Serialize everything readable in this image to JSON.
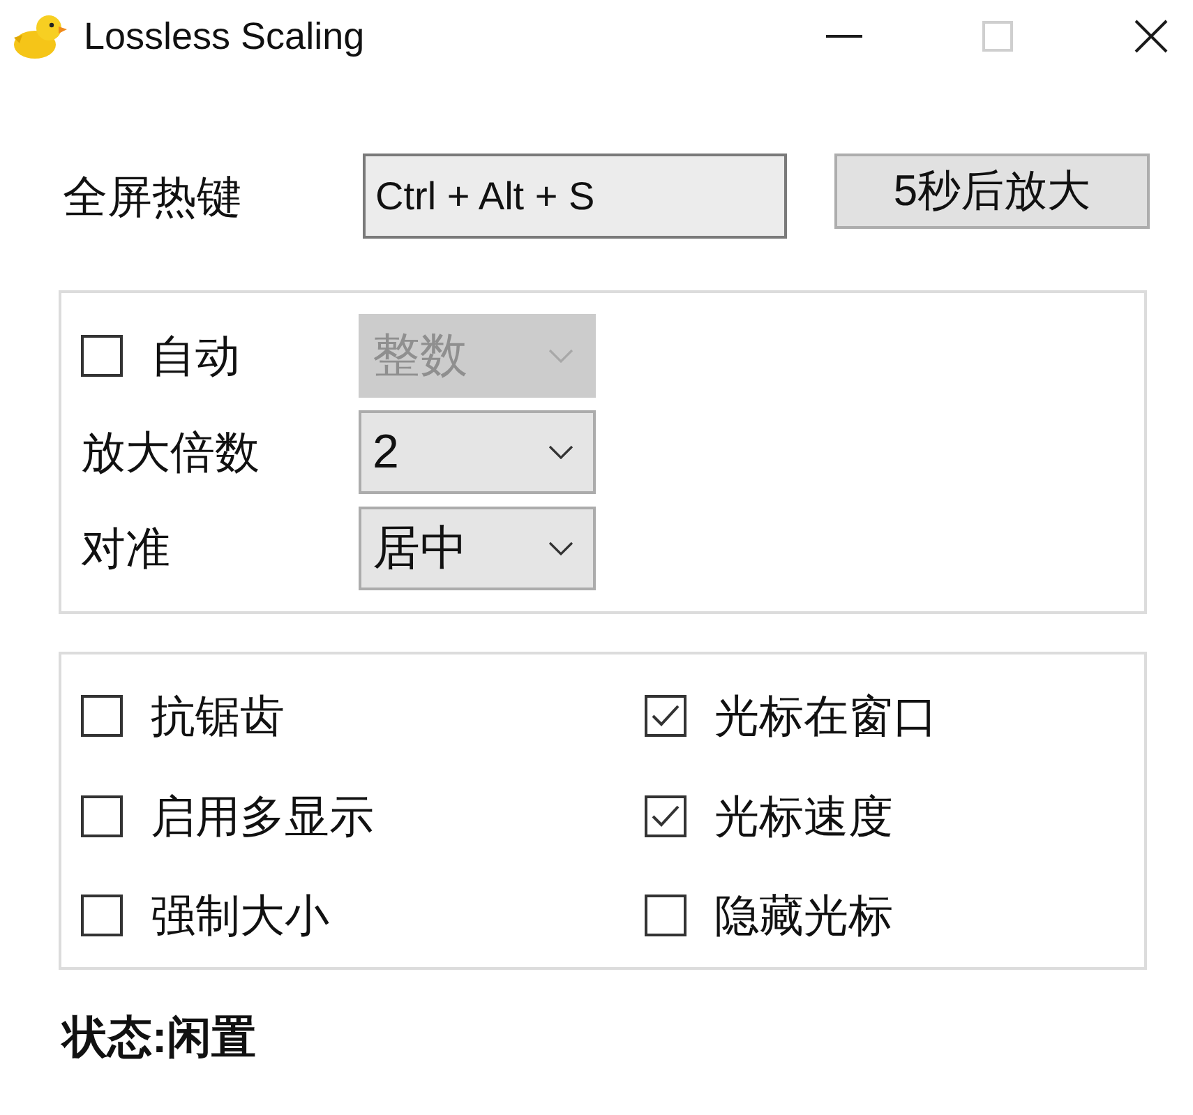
{
  "window": {
    "title": "Lossless Scaling",
    "buttons": [
      {
        "kind": "minimize",
        "disabled": false
      },
      {
        "kind": "maximize",
        "disabled": true
      },
      {
        "kind": "close",
        "disabled": false
      }
    ]
  },
  "hotkey": {
    "label": "全屏热键",
    "value": "Ctrl + Alt + S"
  },
  "delay_button": "5秒后放大",
  "scale_group": {
    "auto": {
      "label": "自动",
      "checked": false
    },
    "auto_combo": {
      "value": "整数",
      "disabled": true
    },
    "fields": [
      {
        "label": "放大倍数",
        "value": "2",
        "disabled": false
      },
      {
        "label": "对准",
        "value": "居中",
        "disabled": false
      }
    ]
  },
  "options": [
    {
      "label": "抗锯齿",
      "checked": false
    },
    {
      "label": "光标在窗口",
      "checked": true
    },
    {
      "label": "启用多显示",
      "checked": false
    },
    {
      "label": "光标速度",
      "checked": true
    },
    {
      "label": "强制大小",
      "checked": false
    },
    {
      "label": "隐藏光标",
      "checked": false
    }
  ],
  "status": "状态:闲置"
}
